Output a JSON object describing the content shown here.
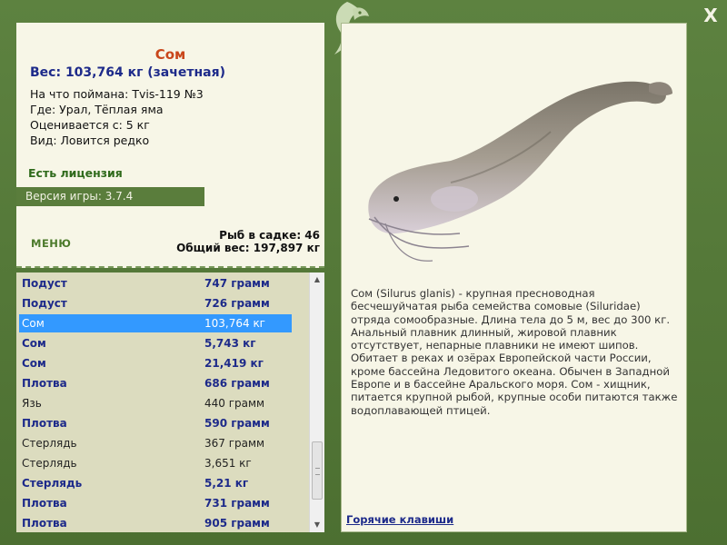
{
  "window": {
    "close_label": "X"
  },
  "info": {
    "fish_name": "Сом",
    "weight_line": "Вес: 103,764 кг (зачетная)",
    "lines": [
      "На что поймана: Tvis-119 №3",
      "Где: Урал, Тёплая яма",
      "Оценивается с: 5 кг",
      "Вид: Ловится редко"
    ],
    "license": "Есть лицензия",
    "version": "Версия игры: 3.7.4",
    "menu_label": "МЕНЮ",
    "fish_count": "Рыб в садке: 46",
    "total_weight": "Общий вес: 197,897 кг"
  },
  "catch_list": [
    {
      "name": "Подуст",
      "weight": "747 грамм",
      "style": "bold"
    },
    {
      "name": "Подуст",
      "weight": "726 грамм",
      "style": "bold"
    },
    {
      "name": "Сом",
      "weight": "103,764 кг",
      "style": "selected"
    },
    {
      "name": "Сом",
      "weight": "5,743 кг",
      "style": "bold"
    },
    {
      "name": "Сом",
      "weight": "21,419 кг",
      "style": "bold"
    },
    {
      "name": "Плотва",
      "weight": "686 грамм",
      "style": "bold"
    },
    {
      "name": "Язь",
      "weight": "440 грамм",
      "style": "plain"
    },
    {
      "name": "Плотва",
      "weight": "590 грамм",
      "style": "bold"
    },
    {
      "name": "Стерлядь",
      "weight": "367 грамм",
      "style": "plain"
    },
    {
      "name": "Стерлядь",
      "weight": "3,651 кг",
      "style": "plain"
    },
    {
      "name": "Стерлядь",
      "weight": "5,21 кг",
      "style": "bold"
    },
    {
      "name": "Плотва",
      "weight": "731 грамм",
      "style": "bold"
    },
    {
      "name": "Плотва",
      "weight": "905 грамм",
      "style": "bold"
    }
  ],
  "description": "Сом (Silurus glanis) - крупная пресноводная бесчешуйчатая рыба семейства сомовые (Siluridae) отряда сомообразные. Длина тела до 5 м, вес до 300 кг. Анальный плавник длинный, жировой плавник отсутствует, непарные плавники не имеют шипов. Обитает в реках и озёрах Европейской части России, кроме бассейна Ледовитого океана. Обычен в Западной Европе и в бассейне Аральского моря. Сом - хищник, питается крупной рыбой, крупные особи питаются также водоплавающей птицей.",
  "hotkeys_label": "Горячие клавиши",
  "icons": {
    "logo": "fish-logo-icon",
    "close": "close-icon",
    "scroll_up": "arrow-up-icon",
    "scroll_down": "arrow-down-icon"
  },
  "colors": {
    "frame": "#4f7233",
    "panel": "#f7f6e7",
    "list_bg": "#dcdcbf",
    "selected": "#3399ff",
    "fish_name": "#c9461a",
    "link": "#1d2a8a"
  }
}
